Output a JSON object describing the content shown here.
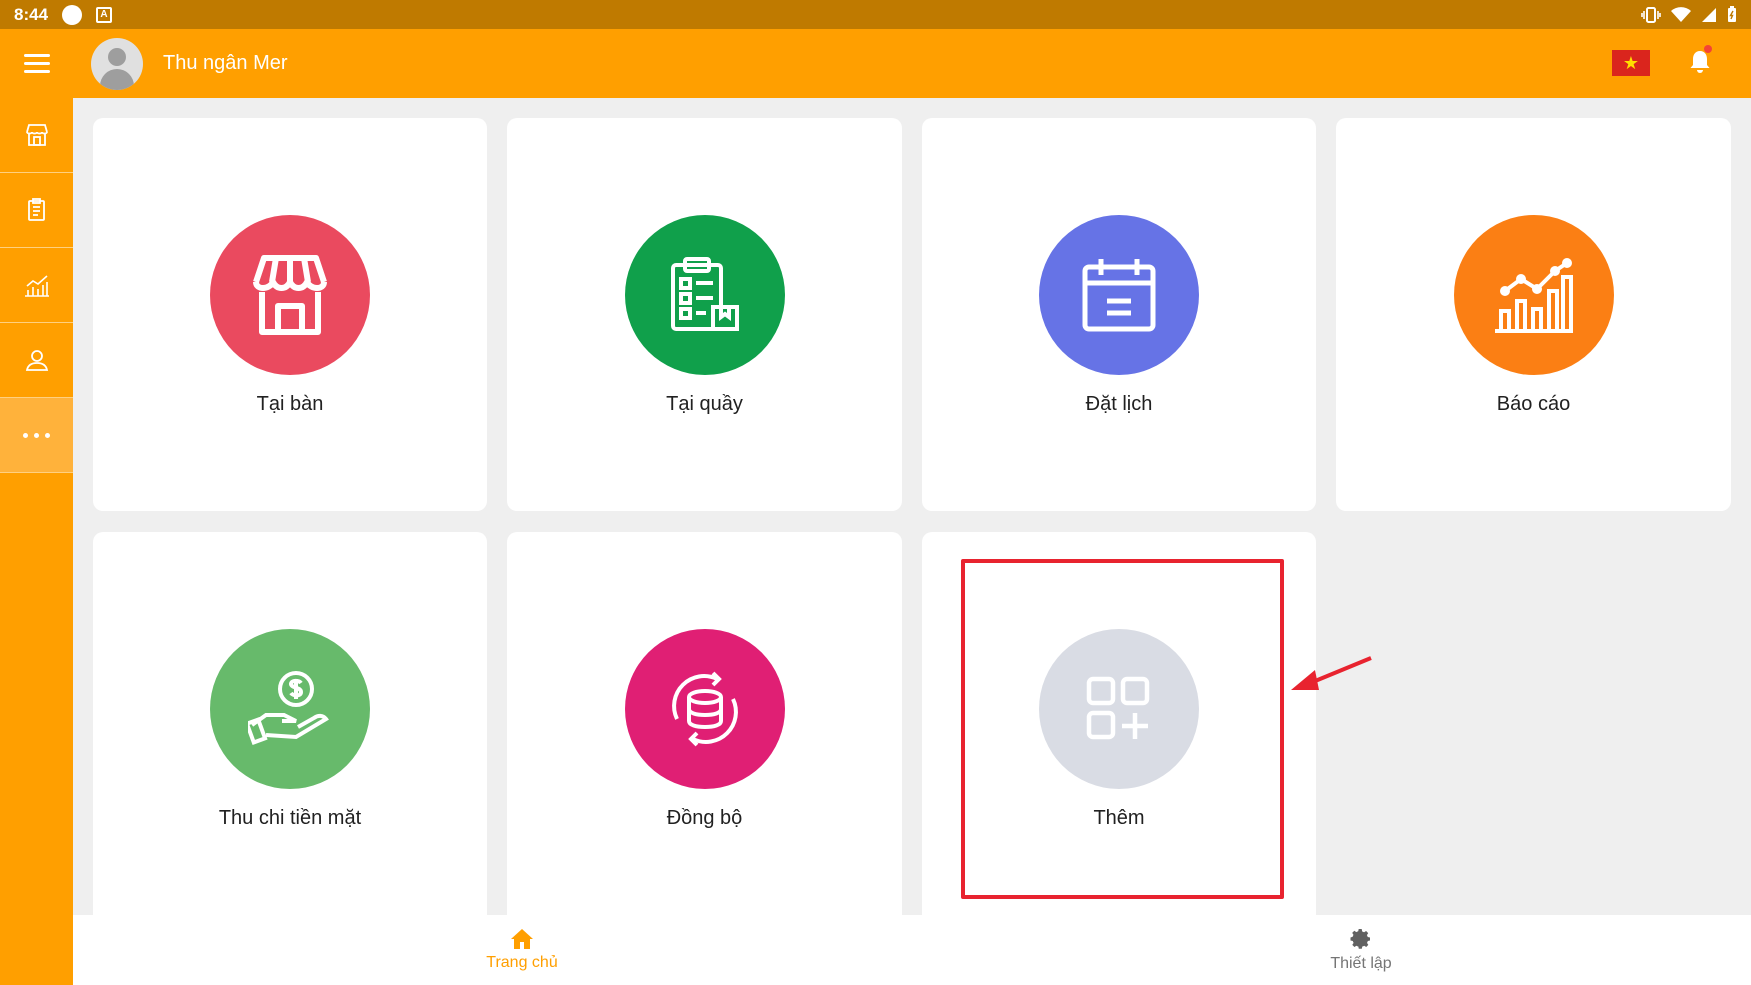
{
  "status_bar": {
    "time": "8:44",
    "notification_icon": "A"
  },
  "header": {
    "username": "Thu ngân Mer",
    "flag_star": "★"
  },
  "sidebar": {
    "items": [
      {
        "icon": "store-icon"
      },
      {
        "icon": "clipboard-icon"
      },
      {
        "icon": "chart-icon"
      },
      {
        "icon": "user-icon"
      },
      {
        "icon": "more-icon"
      }
    ]
  },
  "tiles": [
    {
      "label": "Tại bàn",
      "icon": "store-icon",
      "color": "#ea4a5f"
    },
    {
      "label": "Tại quầy",
      "icon": "clipboard-icon",
      "color": "#10a04b"
    },
    {
      "label": "Đặt lịch",
      "icon": "calendar-icon",
      "color": "#6673e6"
    },
    {
      "label": "Báo cáo",
      "icon": "chart-icon",
      "color": "#fb7f14"
    },
    {
      "label": "Thu chi tiền mặt",
      "icon": "money-hand-icon",
      "color": "#67ba6b"
    },
    {
      "label": "Đồng bộ",
      "icon": "sync-database-icon",
      "color": "#e01f74"
    },
    {
      "label": "Thêm",
      "icon": "add-grid-icon",
      "color": "#d9dce4"
    }
  ],
  "bottom_nav": {
    "home_label": "Trang chủ",
    "settings_label": "Thiết lập"
  },
  "colors": {
    "primary": "#ff9f00",
    "status_bar": "#bf7a00",
    "highlight": "#e8232f"
  }
}
